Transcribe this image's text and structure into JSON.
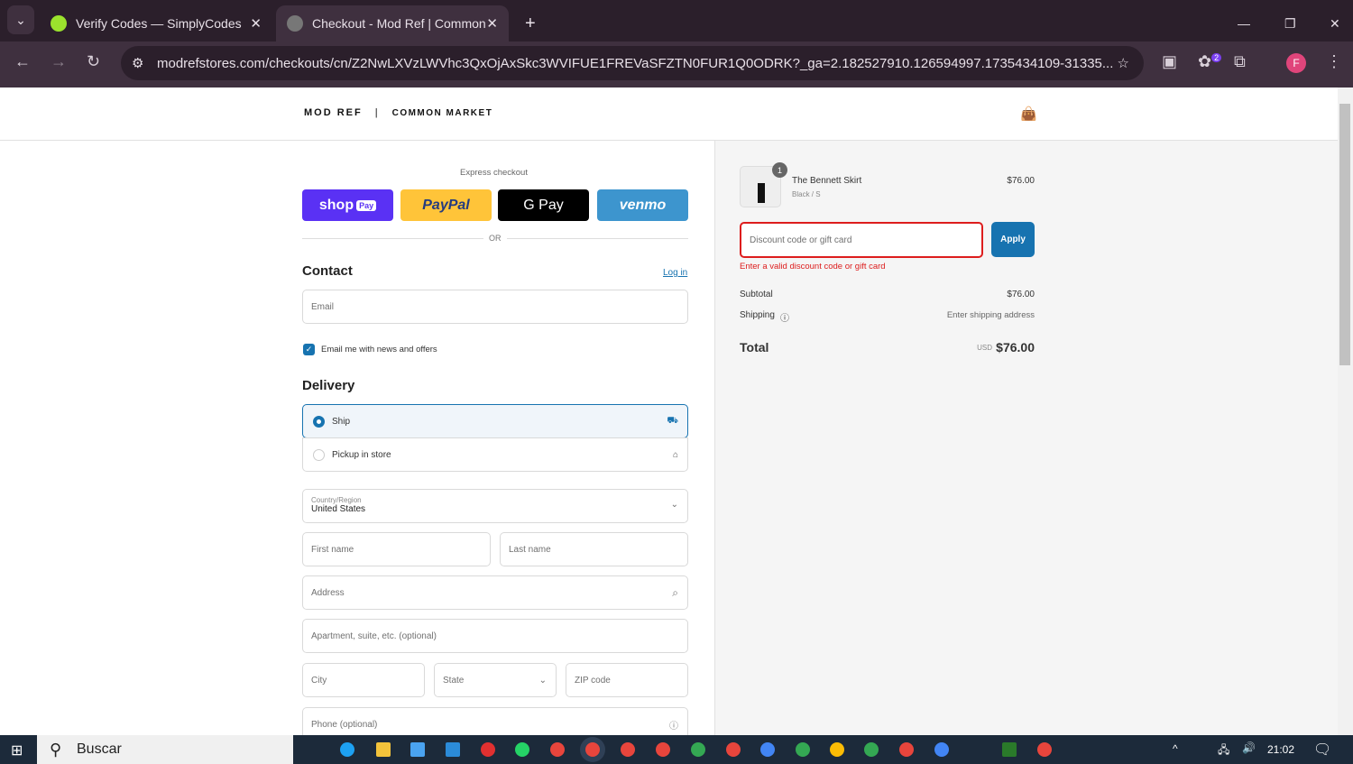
{
  "browser": {
    "tabs": [
      {
        "title": "Verify Codes — SimplyCodes"
      },
      {
        "title": "Checkout - Mod Ref | Common"
      }
    ],
    "url": "modrefstores.com/checkouts/cn/Z2NwLXVzLWVhc3QxOjAxSkc3WVIFUE1FREVaSFZTN0FUR1Q0ODRK?_ga=2.182527910.126594997.1735434109-31335...",
    "profile_initial": "F",
    "extension_badge": "2"
  },
  "header": {
    "brand": "MOD REF",
    "store": "COMMON MARKET"
  },
  "express": {
    "label": "Express checkout",
    "shop": "shop",
    "shop_pay": "Pay",
    "paypal": "PayPal",
    "gpay": "G Pay",
    "venmo": "venmo",
    "or": "OR"
  },
  "contact": {
    "title": "Contact",
    "login": "Log in",
    "email_placeholder": "Email",
    "newsletter": "Email me with news and offers",
    "newsletter_checked": true
  },
  "delivery": {
    "title": "Delivery",
    "ship": "Ship",
    "pickup": "Pickup in store",
    "country_label": "Country/Region",
    "country": "United States",
    "first_name": "First name",
    "last_name": "Last name",
    "address": "Address",
    "apartment": "Apartment, suite, etc. (optional)",
    "city": "City",
    "state": "State",
    "zip": "ZIP code",
    "phone": "Phone (optional)"
  },
  "summary": {
    "item_name": "The Bennett Skirt",
    "item_variant": "Black / S",
    "item_price": "$76.00",
    "item_qty": "1",
    "discount_placeholder": "Discount code or gift card",
    "apply": "Apply",
    "error": "Enter a valid discount code or gift card",
    "subtotal_label": "Subtotal",
    "subtotal": "$76.00",
    "shipping_label": "Shipping",
    "shipping": "Enter shipping address",
    "total_label": "Total",
    "currency": "USD",
    "total": "$76.00"
  },
  "taskbar": {
    "search": "Buscar",
    "time": "21:02"
  },
  "colors": {
    "accent": "#1773b0",
    "error": "#dd1d1d",
    "shop": "#5a31f4",
    "paypal": "#ffc439",
    "venmo": "#3d95ce"
  }
}
